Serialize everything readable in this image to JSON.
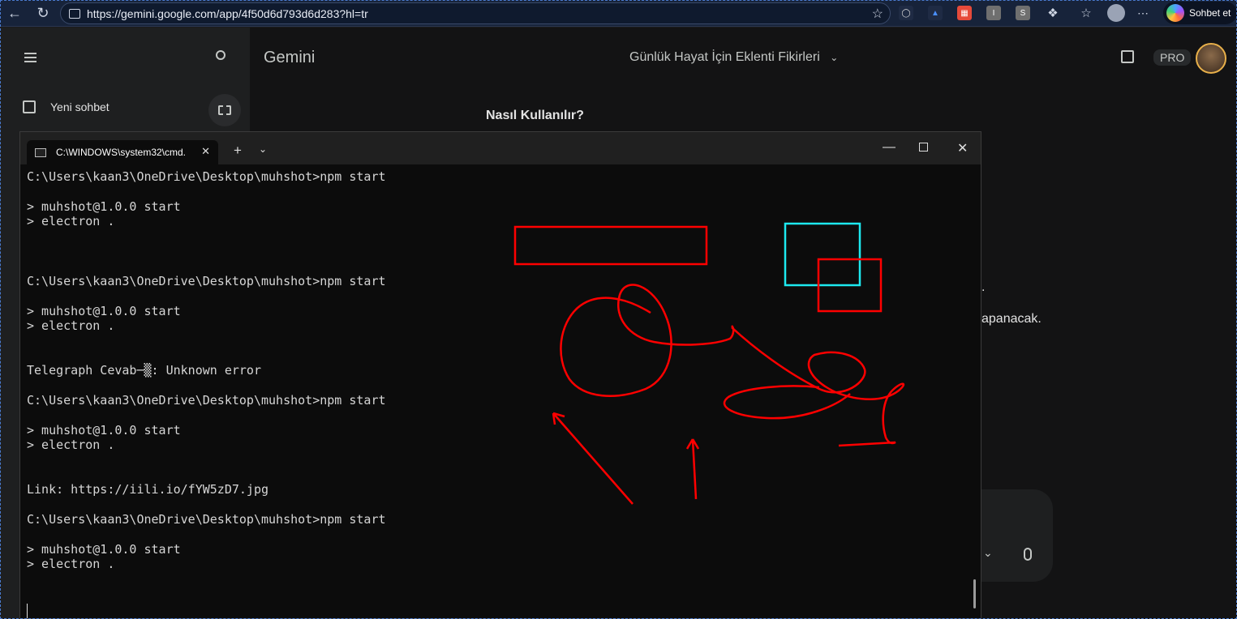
{
  "browser": {
    "url": "https://gemini.google.com/app/4f50d6d793d6d283?hl=tr",
    "copilot_label": "Sohbet et",
    "extensions": [
      {
        "icon": "glasses-icon",
        "color": "#d9d9d9",
        "label": ""
      },
      {
        "icon": "extension-3-icon",
        "color": "#4a8fff",
        "label": ""
      },
      {
        "icon": "calendar-ext-icon",
        "color": "#e64a3a",
        "label": ""
      },
      {
        "icon": "i-ext-icon",
        "color": "#7a7a7a",
        "label": "I"
      },
      {
        "icon": "s-ext-icon",
        "color": "#7a7a7a",
        "label": "S"
      }
    ]
  },
  "gemini": {
    "app_title": "Gemini",
    "conversation_title": "Günlük Hayat İçin Eklenti Fikirleri",
    "new_chat": "Yeni sohbet",
    "pro_badge": "PRO",
    "heading": "Nasıl Kullanılır?",
    "fragment_1": ".",
    "fragment_2": "apanacak."
  },
  "terminal": {
    "tab_title": "C:\\WINDOWS\\system32\\cmd.",
    "lines": [
      "C:\\Users\\kaan3\\OneDrive\\Desktop\\muhshot>npm start",
      "",
      "> muhshot@1.0.0 start",
      "> electron .",
      "",
      "",
      "",
      "C:\\Users\\kaan3\\OneDrive\\Desktop\\muhshot>npm start",
      "",
      "> muhshot@1.0.0 start",
      "> electron .",
      "",
      "",
      "Telegraph Cevab─▒: Unknown error",
      "",
      "C:\\Users\\kaan3\\OneDrive\\Desktop\\muhshot>npm start",
      "",
      "> muhshot@1.0.0 start",
      "> electron .",
      "",
      "",
      "Link: https://iili.io/fYW5zD7.jpg",
      "",
      "C:\\Users\\kaan3\\OneDrive\\Desktop\\muhshot>npm start",
      "",
      "> muhshot@1.0.0 start",
      "> electron ."
    ]
  },
  "annotations": {
    "red": "#ff0000",
    "cyan": "#1de9f0"
  }
}
